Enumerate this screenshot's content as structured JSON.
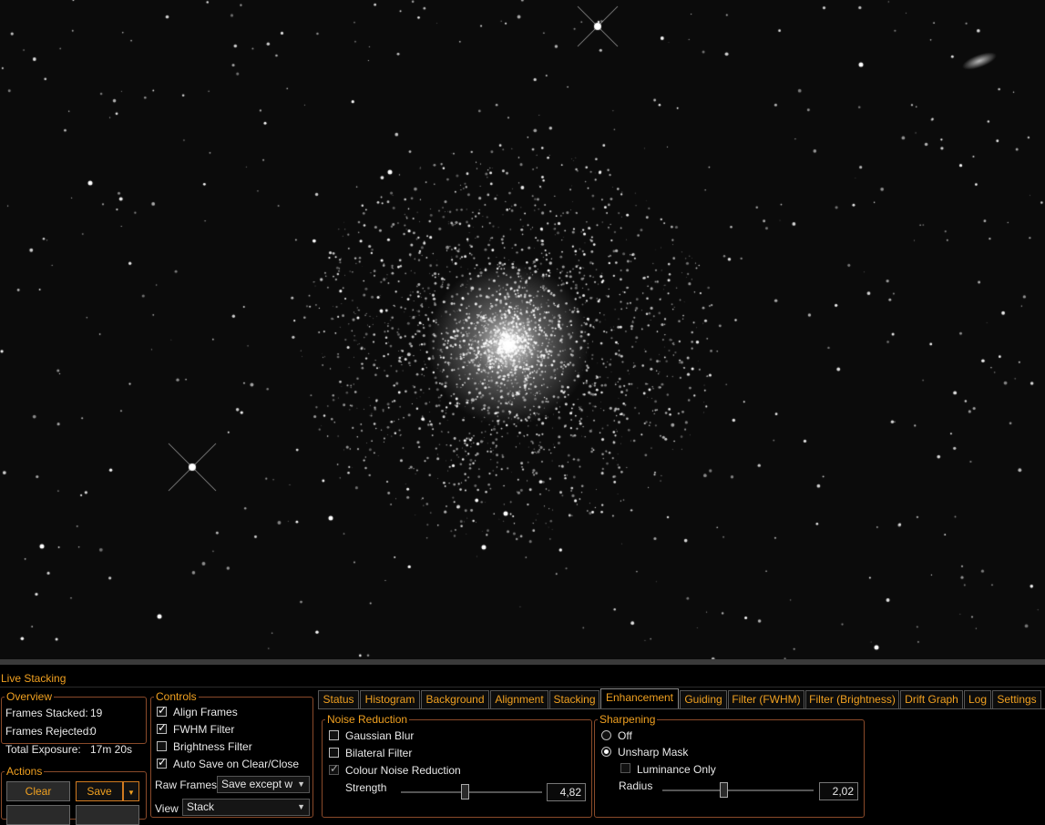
{
  "panel": {
    "title": "Live Stacking"
  },
  "overview": {
    "legend": "Overview",
    "frames_stacked_label": "Frames Stacked:",
    "frames_stacked_value": "19",
    "frames_rejected_label": "Frames Rejected:",
    "frames_rejected_value": "0",
    "total_exposure_label": "Total Exposure:",
    "total_exposure_value": "17m 20s"
  },
  "actions": {
    "legend": "Actions",
    "clear_label": "Clear",
    "save_label": "Save"
  },
  "controls": {
    "legend": "Controls",
    "align_frames": {
      "label": "Align Frames",
      "checked": true
    },
    "fwhm_filter": {
      "label": "FWHM Filter",
      "checked": true
    },
    "brightness_filter": {
      "label": "Brightness Filter",
      "checked": false
    },
    "auto_save": {
      "label": "Auto Save on Clear/Close",
      "checked": true
    },
    "raw_frames_label": "Raw Frames",
    "raw_frames_value": "Save except w",
    "view_label": "View",
    "view_value": "Stack"
  },
  "tabs": [
    {
      "label": "Status"
    },
    {
      "label": "Histogram"
    },
    {
      "label": "Background"
    },
    {
      "label": "Alignment"
    },
    {
      "label": "Stacking"
    },
    {
      "label": "Enhancement",
      "active": true
    },
    {
      "label": "Guiding"
    },
    {
      "label": "Filter (FWHM)"
    },
    {
      "label": "Filter (Brightness)"
    },
    {
      "label": "Drift Graph"
    },
    {
      "label": "Log"
    },
    {
      "label": "Settings"
    }
  ],
  "noise_reduction": {
    "legend": "Noise Reduction",
    "gaussian_blur": {
      "label": "Gaussian Blur",
      "checked": false
    },
    "bilateral_filter": {
      "label": "Bilateral Filter",
      "checked": false
    },
    "colour_noise": {
      "label": "Colour Noise Reduction",
      "checked": true
    },
    "strength_label": "Strength",
    "strength_value": "4,82",
    "strength_fraction": 0.45
  },
  "sharpening": {
    "legend": "Sharpening",
    "off_label": "Off",
    "unsharp_label": "Unsharp Mask",
    "selected": "unsharp",
    "luminance_only": {
      "label": "Luminance Only",
      "checked": false
    },
    "radius_label": "Radius",
    "radius_value": "2,02",
    "radius_fraction": 0.4
  },
  "colors": {
    "accent": "#f0a020",
    "border": "#8a4a2a",
    "background": "#000000"
  }
}
